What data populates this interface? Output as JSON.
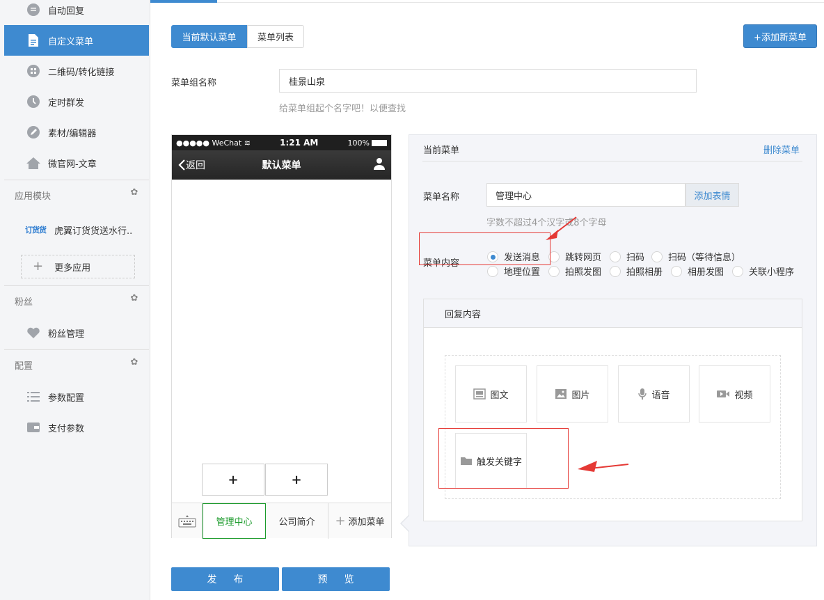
{
  "sidebar": {
    "nav_top": [
      {
        "label": "自动回复",
        "icon": "chat-bubble-icon"
      },
      {
        "label": "自定义菜单",
        "icon": "document-edit-icon",
        "active": true
      },
      {
        "label": "二维码/转化链接",
        "icon": "qrcode-icon"
      },
      {
        "label": "定时群发",
        "icon": "clock-icon"
      },
      {
        "label": "素材/编辑器",
        "icon": "pencil-icon"
      },
      {
        "label": "微官网-文章",
        "icon": "home-icon"
      }
    ],
    "section_apps": "应用模块",
    "app_logo": "订货货",
    "app_name": "虎翼订货货送水行..",
    "more_apps": "更多应用",
    "section_fans": "粉丝",
    "fans_item": "粉丝管理",
    "section_config": "配置",
    "config_items": [
      {
        "label": "参数配置",
        "icon": "list-icon"
      },
      {
        "label": "支付参数",
        "icon": "wallet-icon"
      }
    ]
  },
  "tabs": {
    "current_default": "当前默认菜单",
    "menu_list": "菜单列表"
  },
  "add_new_menu": "+添加新菜单",
  "group": {
    "label": "菜单组名称",
    "value": "桂景山泉",
    "hint": "给菜单组起个名字吧！以便查找"
  },
  "phone": {
    "carrier": "●●●●● WeChat",
    "time": "1:21 AM",
    "battery": "100%",
    "back": "返回",
    "title": "默认菜单",
    "sub_plus": "+",
    "menu_items": [
      "管理中心",
      "公司简介"
    ],
    "add_menu": "添加菜单"
  },
  "panel": {
    "current_menu": "当前菜单",
    "delete_menu": "删除菜单",
    "name_label": "菜单名称",
    "name_value": "管理中心",
    "emoji_btn": "添加表情",
    "name_hint": "字数不超过4个汉字或8个字母",
    "content_label": "菜单内容",
    "options_row1": [
      "发送消息",
      "跳转网页",
      "扫码",
      "扫码（等待信息）"
    ],
    "options_row2": [
      "地理位置",
      "拍照发图",
      "拍照相册",
      "相册发图",
      "关联小程序"
    ],
    "reply_title": "回复内容",
    "reply_types": [
      "图文",
      "图片",
      "语音",
      "视频"
    ],
    "keyword_trigger": "触发关键字"
  },
  "buttons": {
    "publish": "发布",
    "preview": "预览"
  },
  "colors": {
    "primary": "#3e8ad0",
    "active_green": "#1a9a2a",
    "annotation_red": "#e53935"
  }
}
